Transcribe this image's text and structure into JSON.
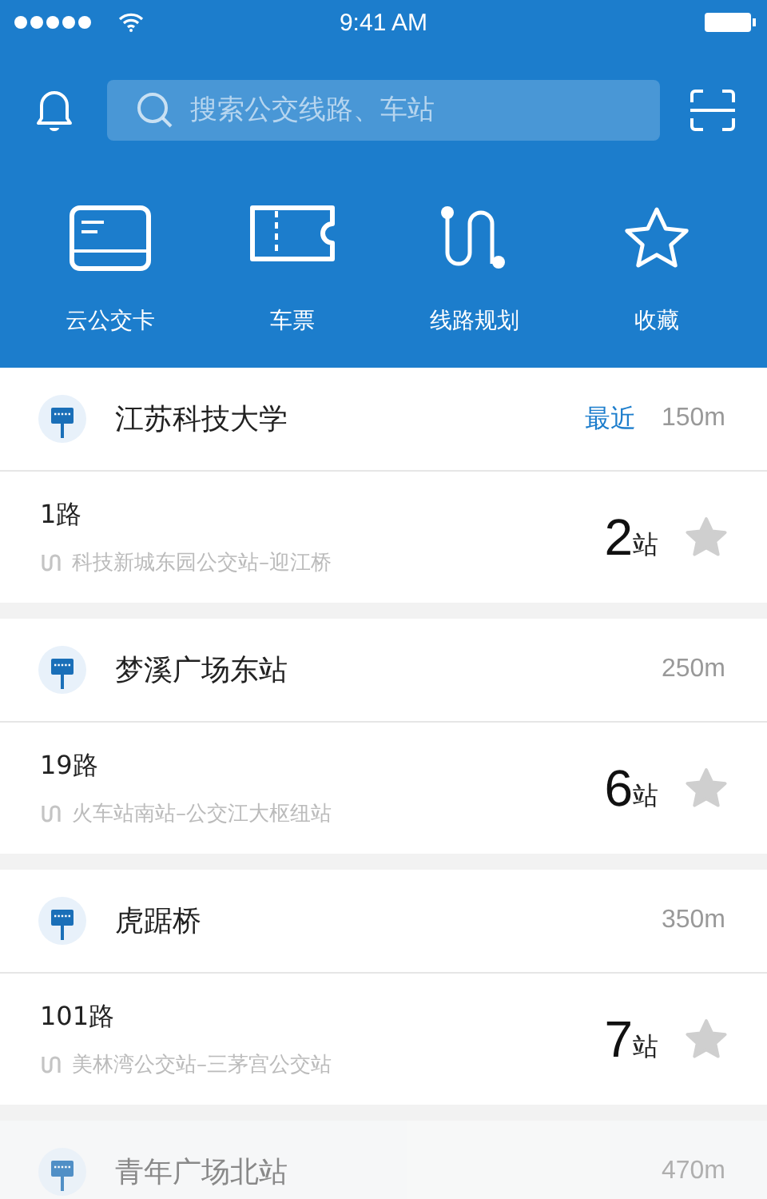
{
  "status_bar": {
    "time": "9:41 AM"
  },
  "search": {
    "placeholder": "搜索公交线路、车站"
  },
  "shortcuts": [
    {
      "kind": "card",
      "label": "云公交卡"
    },
    {
      "kind": "ticket",
      "label": "车票"
    },
    {
      "kind": "route",
      "label": "线路规划"
    },
    {
      "kind": "star",
      "label": "收藏"
    }
  ],
  "stations": [
    {
      "name": "江苏科技大学",
      "tag": "最近",
      "distance": "150m",
      "dimmed": false,
      "line": {
        "name": "1路",
        "route": "科技新城东园公交站–迎江桥",
        "stops": "2",
        "unit": "站",
        "favorite": false
      }
    },
    {
      "name": "梦溪广场东站",
      "distance": "250m",
      "dimmed": false,
      "line": {
        "name": "19路",
        "route": "火车站南站–公交江大枢纽站",
        "stops": "6",
        "unit": "站",
        "favorite": false
      }
    },
    {
      "name": "虎踞桥",
      "distance": "350m",
      "dimmed": false,
      "line": {
        "name": "101路",
        "route": "美林湾公交站–三茅宫公交站",
        "stops": "7",
        "unit": "站",
        "favorite": false
      }
    },
    {
      "name": "青年广场北站",
      "distance": "470m",
      "dimmed": true
    }
  ]
}
